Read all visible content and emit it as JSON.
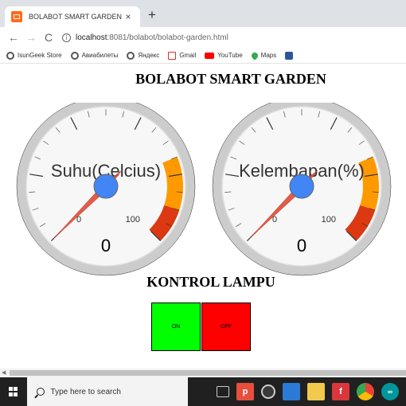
{
  "browser": {
    "tab_title": "BOLABOT SMART GARDEN",
    "tab_close": "×",
    "new_tab": "+",
    "back": "←",
    "forward": "→",
    "reload": "C",
    "url_host": "localhost",
    "url_path": ":8081/bolabot/bolabot-garden.html",
    "bookmarks": [
      {
        "label": "IsunGeek Store",
        "icon": "globe-icon"
      },
      {
        "label": "Авиабилеты",
        "icon": "globe-icon"
      },
      {
        "label": "Яндекс",
        "icon": "globe-icon"
      },
      {
        "label": "Gmail",
        "icon": "gmail-icon"
      },
      {
        "label": "YouTube",
        "icon": "youtube-icon"
      },
      {
        "label": "Maps",
        "icon": "maps-icon"
      }
    ]
  },
  "page": {
    "title": "BOLABOT SMART GARDEN",
    "gauges": [
      {
        "label": "Suhu(Celcius)",
        "value": 0,
        "min_label": "0",
        "max_label": "100",
        "min": 0,
        "max": 100,
        "needle_value": 0
      },
      {
        "label": "Kelembapan(%)",
        "value": 0,
        "min_label": "0",
        "max_label": "100",
        "min": 0,
        "max": 100,
        "needle_value": 0
      }
    ],
    "lamp_title": "KONTROL LAMPU",
    "on_label": "ON",
    "off_label": "OFF",
    "colors": {
      "on": "#00ff00",
      "off": "#ff0000",
      "needle": "#dc4c3a",
      "hub": "#4285f4",
      "yellow_band": "#ff9900",
      "red_band": "#dc3912"
    }
  },
  "taskbar": {
    "search_placeholder": "Type here to search",
    "apps": [
      "task-view-icon",
      "app-red-icon",
      "vpn-icon",
      "app-blue-icon",
      "file-explorer-icon",
      "app-f-icon",
      "chrome-icon",
      "arduino-icon"
    ]
  }
}
